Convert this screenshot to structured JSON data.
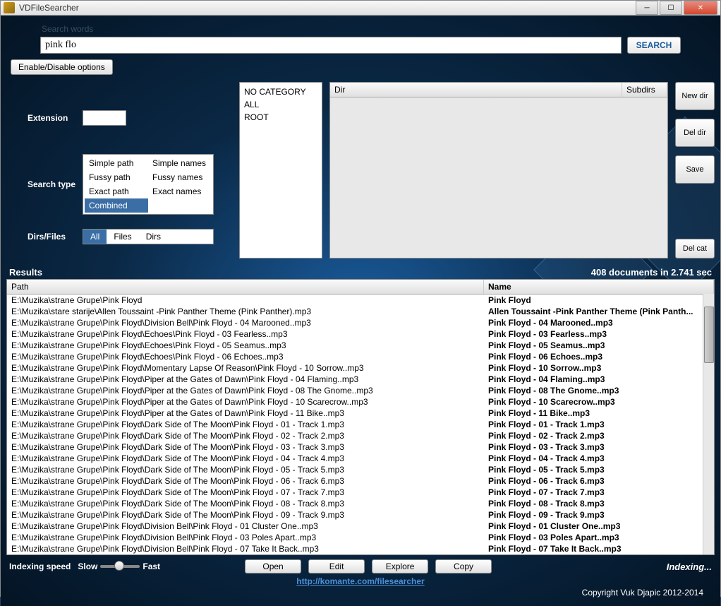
{
  "window_title": "VDFileSearcher",
  "search_words_label": "Search words",
  "search_value": "pink flo",
  "search_button": "SEARCH",
  "options_toggle": "Enable/Disable options",
  "labels": {
    "extension": "Extension",
    "search_type": "Search type",
    "dirs_files": "Dirs/Files"
  },
  "extension_value": "",
  "search_types": {
    "simple_path": "Simple path",
    "simple_names": "Simple names",
    "fussy_path": "Fussy path",
    "fussy_names": "Fussy  names",
    "exact_path": "Exact path",
    "exact_names": "Exact names",
    "combined": "Combined",
    "selected": "combined"
  },
  "dirs_files_options": {
    "all": "All",
    "files": "Files",
    "dirs": "Dirs",
    "selected": "all"
  },
  "categories": [
    "NO CATEGORY",
    "ALL",
    "ROOT"
  ],
  "dir_table": {
    "col_dir": "Dir",
    "col_subdirs": "Subdirs"
  },
  "side_buttons": {
    "new_dir": "New dir",
    "del_dir": "Del dir",
    "save": "Save",
    "del_cat": "Del cat"
  },
  "results_label": "Results",
  "results_summary": "408 documents in 2.741 sec",
  "results_columns": {
    "path": "Path",
    "name": "Name"
  },
  "results": [
    {
      "path": "E:\\Muzika\\strane Grupe\\Pink Floyd",
      "name": "Pink Floyd"
    },
    {
      "path": "E:\\Muzika\\stare starije\\Allen Toussaint -Pink Panther Theme (Pink Panther).mp3",
      "name": "Allen Toussaint -Pink Panther Theme (Pink Panth..."
    },
    {
      "path": "E:\\Muzika\\strane Grupe\\Pink Floyd\\Division Bell\\Pink Floyd - 04 Marooned..mp3",
      "name": "Pink Floyd - 04 Marooned..mp3"
    },
    {
      "path": "E:\\Muzika\\strane Grupe\\Pink Floyd\\Echoes\\Pink Floyd - 03 Fearless..mp3",
      "name": "Pink Floyd - 03 Fearless..mp3"
    },
    {
      "path": "E:\\Muzika\\strane Grupe\\Pink Floyd\\Echoes\\Pink Floyd - 05 Seamus..mp3",
      "name": "Pink Floyd - 05 Seamus..mp3"
    },
    {
      "path": "E:\\Muzika\\strane Grupe\\Pink Floyd\\Echoes\\Pink Floyd - 06 Echoes..mp3",
      "name": "Pink Floyd - 06 Echoes..mp3"
    },
    {
      "path": "E:\\Muzika\\strane Grupe\\Pink Floyd\\Momentary Lapse Of Reason\\Pink Floyd - 10 Sorrow..mp3",
      "name": "Pink Floyd - 10 Sorrow..mp3"
    },
    {
      "path": "E:\\Muzika\\strane Grupe\\Pink Floyd\\Piper at the Gates of Dawn\\Pink Floyd - 04 Flaming..mp3",
      "name": "Pink Floyd - 04 Flaming..mp3"
    },
    {
      "path": "E:\\Muzika\\strane Grupe\\Pink Floyd\\Piper at the Gates of Dawn\\Pink Floyd - 08 The Gnome..mp3",
      "name": "Pink Floyd - 08 The Gnome..mp3"
    },
    {
      "path": "E:\\Muzika\\strane Grupe\\Pink Floyd\\Piper at the Gates of Dawn\\Pink Floyd - 10 Scarecrow..mp3",
      "name": "Pink Floyd - 10 Scarecrow..mp3"
    },
    {
      "path": "E:\\Muzika\\strane Grupe\\Pink Floyd\\Piper at the Gates of Dawn\\Pink Floyd - 11 Bike..mp3",
      "name": "Pink Floyd - 11 Bike..mp3"
    },
    {
      "path": "E:\\Muzika\\strane Grupe\\Pink Floyd\\Dark Side of The Moon\\Pink Floyd - 01 - Track  1.mp3",
      "name": "Pink Floyd - 01 - Track  1.mp3"
    },
    {
      "path": "E:\\Muzika\\strane Grupe\\Pink Floyd\\Dark Side of The Moon\\Pink Floyd - 02 - Track  2.mp3",
      "name": "Pink Floyd - 02 - Track  2.mp3"
    },
    {
      "path": "E:\\Muzika\\strane Grupe\\Pink Floyd\\Dark Side of The Moon\\Pink Floyd - 03 - Track  3.mp3",
      "name": "Pink Floyd - 03 - Track  3.mp3"
    },
    {
      "path": "E:\\Muzika\\strane Grupe\\Pink Floyd\\Dark Side of The Moon\\Pink Floyd - 04 - Track  4.mp3",
      "name": "Pink Floyd - 04 - Track  4.mp3"
    },
    {
      "path": "E:\\Muzika\\strane Grupe\\Pink Floyd\\Dark Side of The Moon\\Pink Floyd - 05 - Track  5.mp3",
      "name": "Pink Floyd - 05 - Track  5.mp3"
    },
    {
      "path": "E:\\Muzika\\strane Grupe\\Pink Floyd\\Dark Side of The Moon\\Pink Floyd - 06 - Track  6.mp3",
      "name": "Pink Floyd - 06 - Track  6.mp3"
    },
    {
      "path": "E:\\Muzika\\strane Grupe\\Pink Floyd\\Dark Side of The Moon\\Pink Floyd - 07 - Track  7.mp3",
      "name": "Pink Floyd - 07 - Track  7.mp3"
    },
    {
      "path": "E:\\Muzika\\strane Grupe\\Pink Floyd\\Dark Side of The Moon\\Pink Floyd - 08 - Track  8.mp3",
      "name": "Pink Floyd - 08 - Track  8.mp3"
    },
    {
      "path": "E:\\Muzika\\strane Grupe\\Pink Floyd\\Dark Side of The Moon\\Pink Floyd - 09 - Track  9.mp3",
      "name": "Pink Floyd - 09 - Track  9.mp3"
    },
    {
      "path": "E:\\Muzika\\strane Grupe\\Pink Floyd\\Division Bell\\Pink Floyd - 01 Cluster One..mp3",
      "name": "Pink Floyd - 01 Cluster One..mp3"
    },
    {
      "path": "E:\\Muzika\\strane Grupe\\Pink Floyd\\Division Bell\\Pink Floyd - 03 Poles Apart..mp3",
      "name": "Pink Floyd - 03 Poles Apart..mp3"
    },
    {
      "path": "E:\\Muzika\\strane Grupe\\Pink Floyd\\Division Bell\\Pink Floyd - 07 Take It Back..mp3",
      "name": "Pink Floyd - 07 Take It Back..mp3"
    }
  ],
  "bottom_bar": {
    "indexing_speed_label": "Indexing speed",
    "slow": "Slow",
    "fast": "Fast",
    "open": "Open",
    "edit": "Edit",
    "explore": "Explore",
    "copy": "Copy",
    "indexing_status": "Indexing..."
  },
  "link_text": "http://komante.com/filesearcher",
  "copyright": "Copyright Vuk Djapic 2012-2014"
}
